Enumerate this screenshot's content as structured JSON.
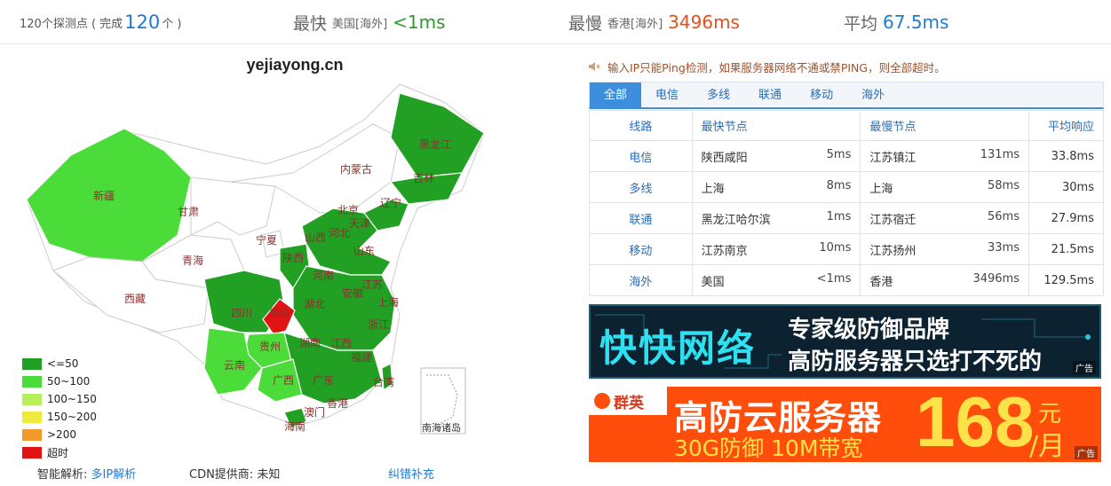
{
  "summary": {
    "total_prefix": "120个探测点 ( 完成",
    "total_count": "120",
    "total_suffix": "个 )",
    "fastest_label": "最快",
    "fastest_loc": "美国[海外]",
    "fastest_val": "<1ms",
    "slowest_label": "最慢",
    "slowest_loc": "香港[海外]",
    "slowest_val": "3496ms",
    "avg_label": "平均",
    "avg_val": "67.5ms"
  },
  "map": {
    "title": "yejiayong.cn",
    "provinces": [
      "新疆",
      "甘肃",
      "青海",
      "西藏",
      "内蒙古",
      "黑龙江",
      "吉林",
      "辽宁",
      "北京",
      "天津",
      "河北",
      "山西",
      "宁夏",
      "陕西",
      "山东",
      "河南",
      "江苏",
      "安徽",
      "上海",
      "四川",
      "湖北",
      "重庆",
      "浙江",
      "贵州",
      "湖南",
      "江西",
      "福建",
      "云南",
      "广西",
      "广东",
      "台湾",
      "香港",
      "澳门",
      "海南",
      "南海诸岛"
    ],
    "legend": [
      {
        "label": "<=50",
        "color": "#22a023"
      },
      {
        "label": "50~100",
        "color": "#4cdc3a"
      },
      {
        "label": "100~150",
        "color": "#b7ef5a"
      },
      {
        "label": "150~200",
        "color": "#f0ea3c"
      },
      {
        "label": ">200",
        "color": "#f39a2a"
      },
      {
        "label": "超时",
        "color": "#e11414"
      }
    ],
    "footer": {
      "dns_label": "智能解析:",
      "dns_link": "多IP解析",
      "cdn_label": "CDN提供商:",
      "cdn_value": "未知",
      "report_link": "纠错补充"
    }
  },
  "notice": "输入IP只能Ping检测，如果服务器网络不通或禁PING，则全部超时。",
  "tabs": [
    "全部",
    "电信",
    "多线",
    "联通",
    "移动",
    "海外"
  ],
  "table": {
    "headers": [
      "线路",
      "最快节点",
      "最慢节点",
      "平均响应"
    ],
    "rows": [
      {
        "line": "电信",
        "fast_node": "陕西咸阳",
        "fast_ms": "5ms",
        "slow_node": "江苏镇江",
        "slow_ms": "131ms",
        "avg": "33.8ms"
      },
      {
        "line": "多线",
        "fast_node": "上海",
        "fast_ms": "8ms",
        "slow_node": "上海",
        "slow_ms": "58ms",
        "avg": "30ms"
      },
      {
        "line": "联通",
        "fast_node": "黑龙江哈尔滨",
        "fast_ms": "1ms",
        "slow_node": "江苏宿迁",
        "slow_ms": "56ms",
        "avg": "27.9ms"
      },
      {
        "line": "移动",
        "fast_node": "江苏南京",
        "fast_ms": "10ms",
        "slow_node": "江苏扬州",
        "slow_ms": "33ms",
        "avg": "21.5ms"
      },
      {
        "line": "海外",
        "fast_node": "美国",
        "fast_ms": "<1ms",
        "slow_node": "香港",
        "slow_ms": "3496ms",
        "avg": "129.5ms"
      }
    ]
  },
  "ads": {
    "ad1": {
      "brand": "快快网络",
      "line1": "专家级防御品牌",
      "line2": "高防服务器只选打不死的",
      "tag": "广告"
    },
    "ad2": {
      "brand": "群英",
      "headline": "高防云服务器",
      "sub": "30G防御 10M带宽",
      "price": "168",
      "unit_top": "元",
      "unit_bottom": "/月",
      "tag": "广告"
    }
  },
  "colors": {
    "accent": "#3c8fdc",
    "fast": "#2e9a2e",
    "slow": "#e4501c",
    "avg": "#1f7ad6"
  }
}
